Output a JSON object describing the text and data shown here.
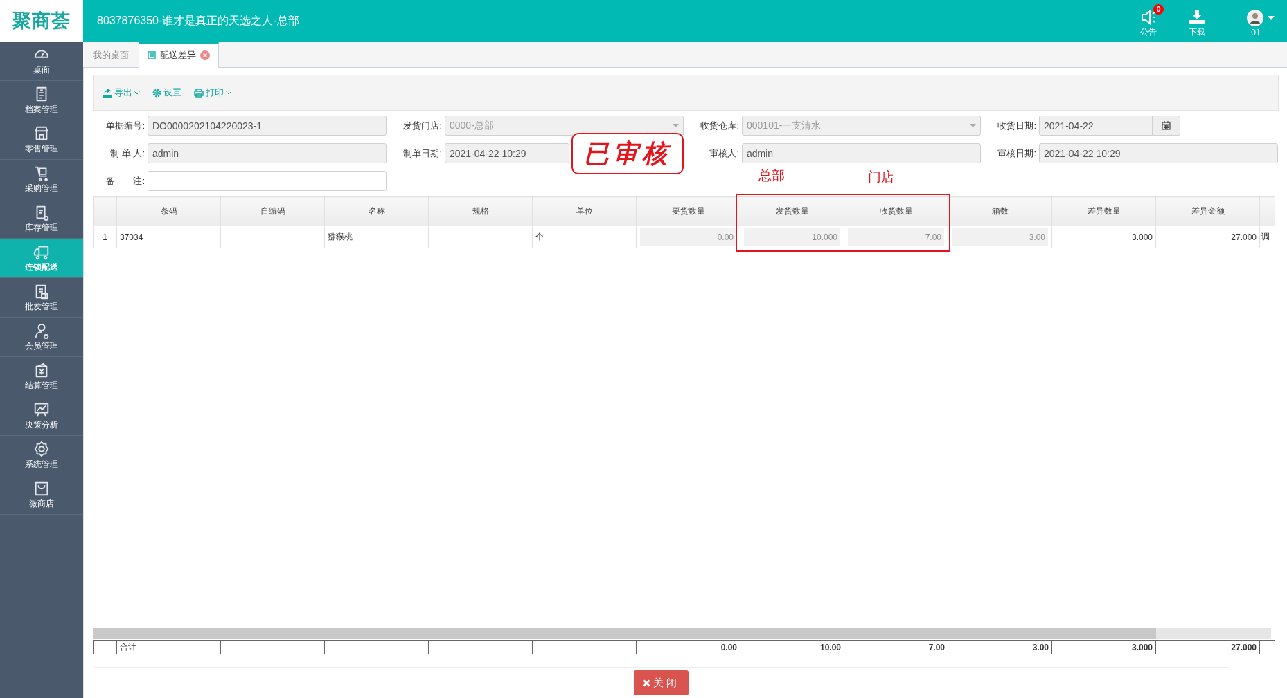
{
  "header": {
    "logo": "聚商荟",
    "title": "8037876350-谁才是真正的天选之人-总部",
    "actions": [
      {
        "kind": "notice",
        "label": "公告",
        "badge": "0"
      },
      {
        "kind": "download",
        "label": "下载"
      },
      {
        "kind": "user",
        "label": "01"
      }
    ]
  },
  "sidebar": {
    "items": [
      {
        "label": "桌面",
        "selected": false
      },
      {
        "label": "档案管理",
        "selected": false
      },
      {
        "label": "零售管理",
        "selected": false
      },
      {
        "label": "采购管理",
        "selected": false
      },
      {
        "label": "库存管理",
        "selected": false
      },
      {
        "label": "连锁配送",
        "selected": true
      },
      {
        "label": "批发管理",
        "selected": false
      },
      {
        "label": "会员管理",
        "selected": false
      },
      {
        "label": "结算管理",
        "selected": false
      },
      {
        "label": "决策分析",
        "selected": false
      },
      {
        "label": "系统管理",
        "selected": false
      },
      {
        "label": "微商店",
        "selected": false
      }
    ]
  },
  "tabs": [
    {
      "label": "我的桌面",
      "selected": false,
      "closable": false
    },
    {
      "label": "配送差异",
      "selected": true,
      "closable": true
    }
  ],
  "toolbar": [
    {
      "kind": "export",
      "label": "导出",
      "dropdown": true
    },
    {
      "kind": "settings",
      "label": "设置",
      "dropdown": false
    },
    {
      "kind": "print",
      "label": "打印",
      "dropdown": true
    }
  ],
  "form": {
    "rows": [
      [
        {
          "label": "单据编号:",
          "kind": "text",
          "value": "DO0000202104220023-1",
          "disabled": true
        },
        {
          "label": "发货门店:",
          "kind": "select",
          "value": "0000-总部",
          "disabled": true
        },
        {
          "label": "收货仓库:",
          "kind": "select",
          "value": "000101-一支清水",
          "disabled": true
        },
        {
          "label": "收货日期:",
          "kind": "date",
          "value": "2021-04-22",
          "disabled": true
        }
      ],
      [
        {
          "label": "制 单 人:",
          "kind": "text",
          "value": "admin",
          "disabled": true
        },
        {
          "label": "制单日期:",
          "kind": "text",
          "value": "2021-04-22 10:29",
          "disabled": true
        },
        {
          "label": "审核人:",
          "kind": "text",
          "value": "admin",
          "disabled": true
        },
        {
          "label": "审核日期:",
          "kind": "text",
          "value": "2021-04-22 10:29",
          "disabled": true
        }
      ],
      [
        {
          "label": "备　　注:",
          "kind": "text",
          "disabled": false
        }
      ]
    ]
  },
  "stamp": {
    "text": "已审核"
  },
  "annotations": {
    "labels": [
      "总部",
      "门店"
    ]
  },
  "table": {
    "columns": [
      {
        "label": "条码",
        "kind": "text",
        "readonly": false
      },
      {
        "label": "自编码",
        "kind": "text",
        "readonly": false
      },
      {
        "label": "名称",
        "kind": "text",
        "readonly": false
      },
      {
        "label": "规格",
        "kind": "text",
        "readonly": false
      },
      {
        "label": "单位",
        "kind": "text",
        "readonly": false
      },
      {
        "label": "要货数量",
        "kind": "number",
        "readonly": true
      },
      {
        "label": "发货数量",
        "kind": "number",
        "readonly": true
      },
      {
        "label": "收货数量",
        "kind": "number",
        "readonly": true
      },
      {
        "label": "箱数",
        "kind": "number",
        "readonly": true
      },
      {
        "label": "差异数量",
        "kind": "number",
        "readonly": false
      },
      {
        "label": "差异金额",
        "kind": "number",
        "readonly": false
      },
      {
        "kind": "text",
        "readonly": false
      }
    ],
    "rows": [
      {
        "index": "1",
        "cells": [
          "37034",
          null,
          "猕猴桃",
          null,
          "个",
          "0.00",
          "10.000",
          "7.00",
          "3.00",
          "3.000",
          "27.000",
          "调"
        ]
      }
    ],
    "totals": {
      "label": "合计",
      "values": [
        "0.00",
        "10.00",
        "7.00",
        "3.00",
        "3.000",
        "27.000"
      ]
    }
  },
  "close_button": {
    "label": "关闭"
  }
}
